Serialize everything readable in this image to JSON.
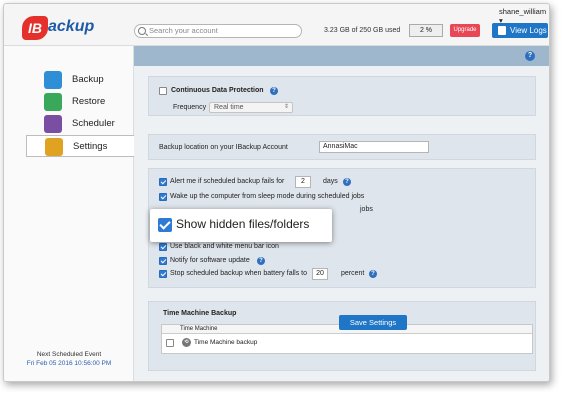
{
  "header": {
    "logo_ib": "IB",
    "logo_text": "ackup",
    "search_placeholder": "Search your account",
    "usage": "3.23 GB of 250 GB used",
    "percent": "2 %",
    "upgrade_label": "Upgrade",
    "view_logs_label": "View Logs",
    "username": "shane_william ▾"
  },
  "sidebar": {
    "items": [
      {
        "label": "Backup",
        "icon": "backup-icon",
        "color": "#2e8ed6"
      },
      {
        "label": "Restore",
        "icon": "restore-icon",
        "color": "#3aa85a"
      },
      {
        "label": "Scheduler",
        "icon": "scheduler-icon",
        "color": "#7a4fa3"
      },
      {
        "label": "Settings",
        "icon": "gear-icon",
        "color": "#e0a321"
      }
    ],
    "next_label": "Next Scheduled Event",
    "next_value": "Fri Feb 05 2016 10:56:00 PM"
  },
  "settings": {
    "cdp_label": "Continuous Data Protection",
    "frequency_label": "Frequency",
    "frequency_value": "Real time",
    "backup_location_label": "Backup location on your IBackup Account",
    "backup_location_value": "AnnasiMac",
    "alert_label": "Alert me if scheduled backup fails for",
    "alert_days": "2",
    "alert_unit": "days",
    "wake_label": "Wake up the computer from sleep mode during scheduled jobs",
    "partial_label": "jobs",
    "show_hidden_label": "Show hidden files/folders",
    "bw_icon_label": "Use black and white menu bar icon",
    "notify_label": "Notify for software update",
    "battery_label": "Stop scheduled backup when battery falls to",
    "battery_value": "20",
    "battery_unit": "percent",
    "time_machine_title": "Time Machine Backup",
    "tm_column": "Time Machine",
    "tm_row": "Time Machine backup",
    "save_label": "Save Settings"
  }
}
